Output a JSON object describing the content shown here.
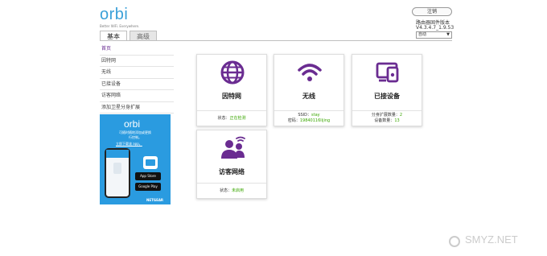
{
  "header": {
    "brand": "orbi",
    "tagline": "Better WiFi. Everywhere.",
    "logout_label": "注销",
    "firmware_label": "路由器固件版本",
    "firmware_version": "V4.3.4.7_1.9.53",
    "language_selected": "自动",
    "accent": "#3aa0d8"
  },
  "tabs": [
    {
      "label": "基本",
      "active": true
    },
    {
      "label": "高级",
      "active": false
    }
  ],
  "sidebar": {
    "items": [
      {
        "label": "首页",
        "active": true
      },
      {
        "label": "因特网",
        "active": false
      },
      {
        "label": "无线",
        "active": false
      },
      {
        "label": "已接设备",
        "active": false
      },
      {
        "label": "访客网络",
        "active": false
      },
      {
        "label": "添加卫星分身扩展",
        "active": false
      }
    ]
  },
  "promo": {
    "brand": "orbi",
    "line1": "可随时随地添加或更换",
    "line2": "行控制。",
    "cta": "立即下载该 app。",
    "app_store": "App Store",
    "google_play": "Google Play",
    "maker": "NETGEAR",
    "color": "#2a9be0"
  },
  "cards": {
    "internet": {
      "title": "因特网",
      "status_label": "状态：",
      "status_value": "正在检测",
      "icon": "globe-icon"
    },
    "wireless": {
      "title": "无线",
      "ssid_label": "SSID：",
      "ssid_value": "stay",
      "key_label": "密码：",
      "key_value": "19840116lijing",
      "icon": "wifi-icon"
    },
    "devices": {
      "title": "已接设备",
      "sat_label": "分身扩展数量：",
      "sat_value": "2",
      "dev_label": "设备数量：",
      "dev_value": "13",
      "icon": "devices-icon"
    },
    "guest": {
      "title": "访客网络",
      "status_label": "状态：",
      "status_value": "未启用",
      "icon": "guest-users-icon"
    }
  },
  "watermark": "SMYZ.NET",
  "icon_color": "#6a2c91"
}
